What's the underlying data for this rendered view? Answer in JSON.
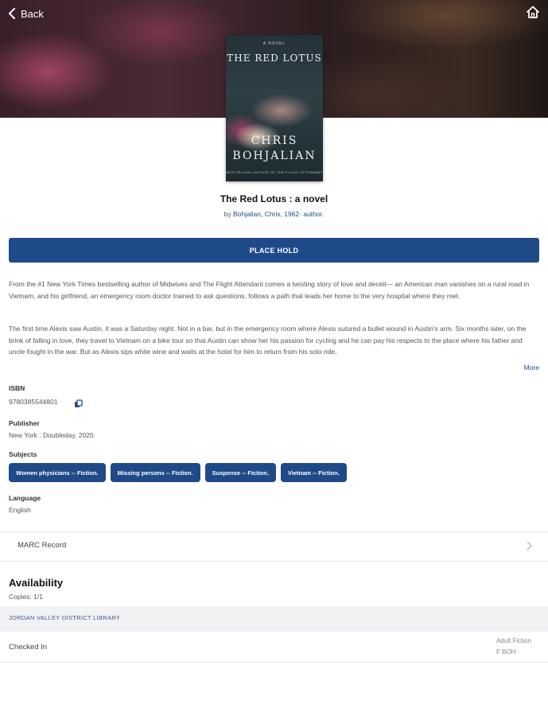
{
  "nav": {
    "back_label": "Back"
  },
  "cover": {
    "top_text": "A NOVEL",
    "title_text": "THE RED LOTUS",
    "author_line1": "CHRIS",
    "author_line2": "BOHJALIAN",
    "blurb": "BESTSELLING AUTHOR OF THE FLIGHT ATTENDANT"
  },
  "book": {
    "title": "The Red Lotus : a novel",
    "by_prefix": "by",
    "author": "Bohjalian, Chris, 1962- author."
  },
  "actions": {
    "place_hold": "PLACE HOLD",
    "more": "More"
  },
  "description": {
    "paragraph1": "From the #1 New York Times bestselling author of Midwives and The Flight Attendant comes a twisting story of love and deceit— an American man vanishes on a rural road in Vietnam, and his girlfriend, an emergency room doctor trained to ask questions, follows a path that leads her home to the very hospital where they met.",
    "paragraph2": "The first time Alexis saw Austin, it was a Saturday night. Not in a bar, but in the emergency room where Alexis sutured a bullet wound in Austin's arm. Six months later, on the brink of falling in love, they travel to Vietnam on a bike tour so that Austin can show her his passion for cycling and he can pay his respects to the place where his father and uncle fought in the war. But as Alexis sips white wine and waits at the hotel for him to return from his solo ride,"
  },
  "details": {
    "isbn_label": "ISBN",
    "isbn_value": "9780385544801",
    "publisher_label": "Publisher",
    "publisher_value": "New York : Doubleday, 2020.",
    "subjects_label": "Subjects",
    "subjects": [
      "Women physicians -- Fiction.",
      "Missing persons -- Fiction.",
      "Suspense -- Fiction.",
      "Vietnam -- Fiction."
    ],
    "language_label": "Language",
    "language_value": "English"
  },
  "marc": {
    "label": "MARC Record"
  },
  "availability": {
    "heading": "Availability",
    "copies": "Copies: 1/1",
    "library": "JORDAN VALLEY DISTRICT LIBRARY",
    "status": "Checked In",
    "shelf_line1": "Adult Fiction",
    "shelf_line2": "F BOH"
  },
  "colors": {
    "accent": "#1f4a8a",
    "library_bar": "#f1f2f4"
  }
}
